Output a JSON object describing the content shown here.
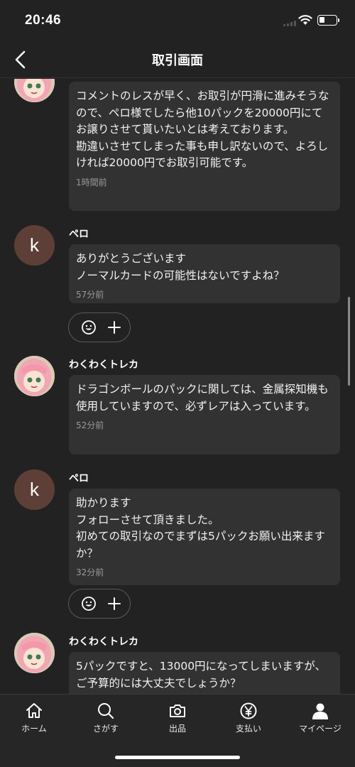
{
  "status": {
    "time": "20:46"
  },
  "header": {
    "title": "取引画面"
  },
  "messages": [
    {
      "sender": "",
      "text": "コメントのレスが早く、お取引が円滑に進みそうなので、ペロ様でしたら他10パックを20000円にてお譲りさせて貰いたいとは考えております。\n勘違いさせてしまった事も申し訳ないので、よろしければ20000円でお取引可能です。",
      "time": "1時間前"
    },
    {
      "sender": "ペロ",
      "avatar_letter": "k",
      "text": "ありがとうございます\nノーマルカードの可能性はないですよね？",
      "time": "57分前"
    },
    {
      "sender": "わくわくトレカ",
      "text": "ドラゴンボールのパックに関しては、金属探知機も使用していますので、必ずレアは入っています。",
      "time": "52分前"
    },
    {
      "sender": "ペロ",
      "avatar_letter": "k",
      "text": "助かります\nフォローさせて頂きました。\n初めての取引なのでまずは5パックお願い出来ますか？",
      "time": "32分前"
    },
    {
      "sender": "わくわくトレカ",
      "text": "5パックですと、13000円になってしまいますが、ご予算的には大丈夫でしょうか？",
      "time": ""
    }
  ],
  "tabs": [
    {
      "label": "ホーム",
      "icon": "home-icon"
    },
    {
      "label": "さがす",
      "icon": "search-icon"
    },
    {
      "label": "出品",
      "icon": "camera-icon"
    },
    {
      "label": "支払い",
      "icon": "yen-icon"
    },
    {
      "label": "マイページ",
      "icon": "person-icon"
    }
  ],
  "colors": {
    "background": "#222222",
    "bubble": "#323232",
    "avatar_k": "#5e3f37",
    "muted_text": "#9a9a9a"
  }
}
